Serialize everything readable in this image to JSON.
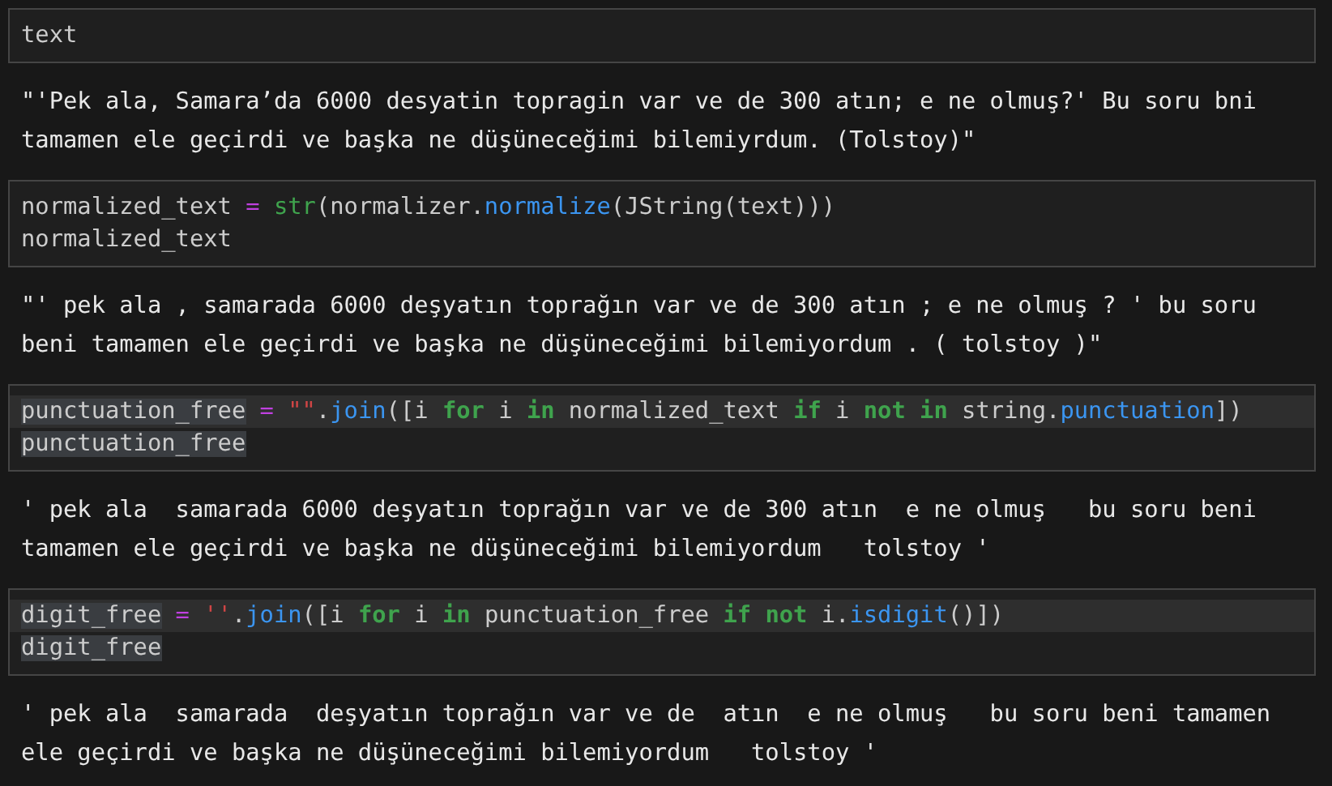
{
  "cells": [
    {
      "kind": "code",
      "lines": [
        {
          "current": false,
          "tokens": [
            {
              "text": "text",
              "kind": "plain"
            }
          ]
        }
      ]
    },
    {
      "kind": "output",
      "lines": [
        "\"'Pek ala, Samara’da 6000 desyatin topragin var ve de 300 atın; e ne olmuş?' Bu soru bni",
        "tamamen ele geçirdi ve başka ne düşüneceğimi bilemiyrdum. (Tolstoy)\""
      ]
    },
    {
      "kind": "code",
      "lines": [
        {
          "current": false,
          "tokens": [
            {
              "text": "normalized_text ",
              "kind": "plain"
            },
            {
              "text": "=",
              "kind": "operator"
            },
            {
              "text": " str",
              "kind": "builtin"
            },
            {
              "text": "(normalizer.",
              "kind": "plain"
            },
            {
              "text": "normalize",
              "kind": "function"
            },
            {
              "text": "(JString(text)))",
              "kind": "plain"
            }
          ]
        },
        {
          "current": false,
          "tokens": [
            {
              "text": "normalized_text",
              "kind": "plain"
            }
          ]
        }
      ]
    },
    {
      "kind": "output",
      "lines": [
        "\"' pek ala , samarada 6000 deşyatın toprağın var ve de 300 atın ; e ne olmuş ? ' bu soru",
        "beni tamamen ele geçirdi ve başka ne düşüneceğimi bilemiyordum . ( tolstoy )\""
      ]
    },
    {
      "kind": "code",
      "lines": [
        {
          "current": true,
          "tokens": [
            {
              "text": "punctuation_free",
              "kind": "plain",
              "match": true
            },
            {
              "text": " = ",
              "kind": "operator"
            },
            {
              "text": "\"\"",
              "kind": "string"
            },
            {
              "text": ".",
              "kind": "plain"
            },
            {
              "text": "join",
              "kind": "function"
            },
            {
              "text": "([i ",
              "kind": "plain"
            },
            {
              "text": "for",
              "kind": "keyword"
            },
            {
              "text": " i ",
              "kind": "plain"
            },
            {
              "text": "in",
              "kind": "keyword"
            },
            {
              "text": " normalized_text ",
              "kind": "plain"
            },
            {
              "text": "if",
              "kind": "keyword"
            },
            {
              "text": " i ",
              "kind": "plain"
            },
            {
              "text": "not in",
              "kind": "keyword"
            },
            {
              "text": " string.",
              "kind": "plain"
            },
            {
              "text": "punctuation",
              "kind": "function"
            },
            {
              "text": "])",
              "kind": "plain"
            }
          ]
        },
        {
          "current": false,
          "tokens": [
            {
              "text": "punctuation_free",
              "kind": "plain",
              "match": true
            }
          ]
        }
      ]
    },
    {
      "kind": "output",
      "lines": [
        "' pek ala  samarada 6000 deşyatın toprağın var ve de 300 atın  e ne olmuş   bu soru beni",
        "tamamen ele geçirdi ve başka ne düşüneceğimi bilemiyordum   tolstoy '"
      ]
    },
    {
      "kind": "code",
      "lines": [
        {
          "current": true,
          "tokens": [
            {
              "text": "digit_free",
              "kind": "plain",
              "match": true
            },
            {
              "text": " = ",
              "kind": "operator"
            },
            {
              "text": "''",
              "kind": "string"
            },
            {
              "text": ".",
              "kind": "plain"
            },
            {
              "text": "join",
              "kind": "function"
            },
            {
              "text": "([i ",
              "kind": "plain"
            },
            {
              "text": "for",
              "kind": "keyword"
            },
            {
              "text": " i ",
              "kind": "plain"
            },
            {
              "text": "in",
              "kind": "keyword"
            },
            {
              "text": " punctuation_free ",
              "kind": "plain"
            },
            {
              "text": "if not",
              "kind": "keyword"
            },
            {
              "text": " i.",
              "kind": "plain"
            },
            {
              "text": "isdigit",
              "kind": "function"
            },
            {
              "text": "()])",
              "kind": "plain"
            }
          ]
        },
        {
          "current": false,
          "tokens": [
            {
              "text": "digit_free",
              "kind": "plain",
              "match": true
            }
          ]
        }
      ]
    },
    {
      "kind": "output",
      "lines": [
        "' pek ala  samarada  deşyatın toprağın var ve de  atın  e ne olmuş   bu soru beni tamamen",
        "ele geçirdi ve başka ne düşüneceğimi bilemiyordum   tolstoy '"
      ]
    }
  ]
}
